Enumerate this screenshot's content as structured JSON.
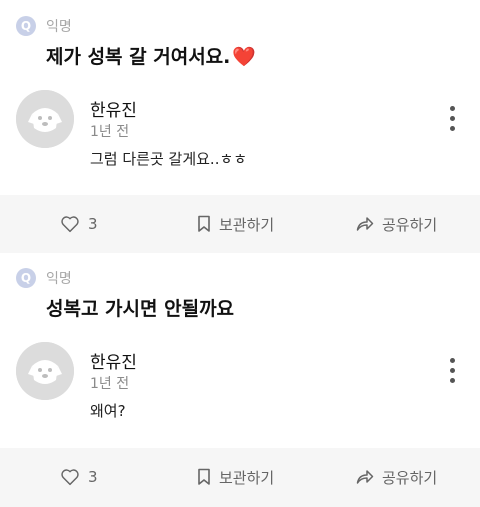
{
  "posts": [
    {
      "badge": "Q",
      "anon_label": "익명",
      "question": "제가 성복 갈 거여서요.",
      "question_emoji": "❤️",
      "reply": {
        "name": "한유진",
        "time": "1년 전",
        "text": "그럼 다른곳 갈게요..ㅎㅎ"
      },
      "actions": {
        "like_count": "3",
        "save_label": "보관하기",
        "share_label": "공유하기"
      }
    },
    {
      "badge": "Q",
      "anon_label": "익명",
      "question": "성복고 가시면 안될까요",
      "question_emoji": "",
      "reply": {
        "name": "한유진",
        "time": "1년 전",
        "text": "왜여?"
      },
      "actions": {
        "like_count": "3",
        "save_label": "보관하기",
        "share_label": "공유하기"
      }
    }
  ],
  "colors": {
    "background": "#f6f6f6",
    "badge": "#c8d0e8",
    "heart": "#e23a3a",
    "avatar_bg": "#dcdcdc"
  },
  "icons": [
    "heart-outline-icon",
    "bookmark-icon",
    "share-arrow-icon",
    "more-vertical-icon",
    "default-avatar-icon"
  ]
}
